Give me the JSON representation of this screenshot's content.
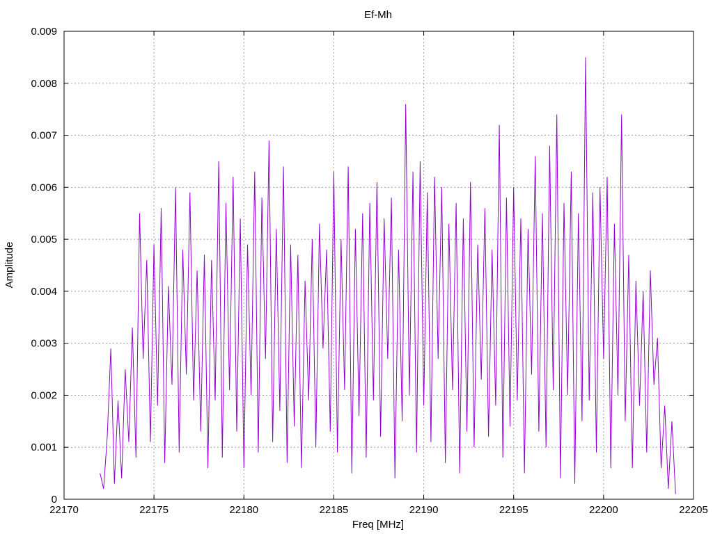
{
  "chart_data": {
    "type": "line",
    "title": "Ef-Mh",
    "xlabel": "Freq [MHz]",
    "ylabel": "Amplitude",
    "xlim": [
      22170,
      22205
    ],
    "ylim": [
      0,
      0.009
    ],
    "x_ticks": [
      22170,
      22175,
      22180,
      22185,
      22190,
      22195,
      22200,
      22205
    ],
    "x_tick_labels": [
      "22170",
      "22175",
      "22180",
      "22185",
      "22190",
      "22195",
      "22200",
      "22205"
    ],
    "y_ticks": [
      0,
      0.001,
      0.002,
      0.003,
      0.004,
      0.005,
      0.006,
      0.007,
      0.008,
      0.009
    ],
    "y_tick_labels": [
      "0",
      "0.001",
      "0.002",
      "0.003",
      "0.004",
      "0.005",
      "0.006",
      "0.007",
      "0.008",
      "0.009"
    ],
    "grid": true,
    "legend": "none",
    "series": [
      {
        "color": "#9400d3",
        "x": [
          22172.0,
          22172.2,
          22172.4,
          22172.6,
          22172.8,
          22173.0,
          22173.2,
          22173.4,
          22173.6,
          22173.8,
          22174.0,
          22174.2,
          22174.4,
          22174.6,
          22174.8,
          22175.0,
          22175.2,
          22175.4,
          22175.6,
          22175.8,
          22176.0,
          22176.2,
          22176.4,
          22176.6,
          22176.8,
          22177.0,
          22177.2,
          22177.4,
          22177.6,
          22177.8,
          22178.0,
          22178.2,
          22178.4,
          22178.6,
          22178.8,
          22179.0,
          22179.2,
          22179.4,
          22179.6,
          22179.8,
          22180.0,
          22180.2,
          22180.4,
          22180.6,
          22180.8,
          22181.0,
          22181.2,
          22181.4,
          22181.6,
          22181.8,
          22182.0,
          22182.2,
          22182.4,
          22182.6,
          22182.8,
          22183.0,
          22183.2,
          22183.4,
          22183.6,
          22183.8,
          22184.0,
          22184.2,
          22184.4,
          22184.6,
          22184.8,
          22185.0,
          22185.2,
          22185.4,
          22185.6,
          22185.8,
          22186.0,
          22186.2,
          22186.4,
          22186.6,
          22186.8,
          22187.0,
          22187.2,
          22187.4,
          22187.6,
          22187.8,
          22188.0,
          22188.2,
          22188.4,
          22188.6,
          22188.8,
          22189.0,
          22189.2,
          22189.4,
          22189.6,
          22189.8,
          22190.0,
          22190.2,
          22190.4,
          22190.6,
          22190.8,
          22191.0,
          22191.2,
          22191.4,
          22191.6,
          22191.8,
          22192.0,
          22192.2,
          22192.4,
          22192.6,
          22192.8,
          22193.0,
          22193.2,
          22193.4,
          22193.6,
          22193.8,
          22194.0,
          22194.2,
          22194.4,
          22194.6,
          22194.8,
          22195.0,
          22195.2,
          22195.4,
          22195.6,
          22195.8,
          22196.0,
          22196.2,
          22196.4,
          22196.6,
          22196.8,
          22197.0,
          22197.2,
          22197.4,
          22197.6,
          22197.8,
          22198.0,
          22198.2,
          22198.4,
          22198.6,
          22198.8,
          22199.0,
          22199.2,
          22199.4,
          22199.6,
          22199.8,
          22200.0,
          22200.2,
          22200.4,
          22200.6,
          22200.8,
          22201.0,
          22201.2,
          22201.4,
          22201.6,
          22201.8,
          22202.0,
          22202.2,
          22202.4,
          22202.6,
          22202.8,
          22203.0,
          22203.2,
          22203.4,
          22203.6,
          22203.8,
          22204.0
        ],
        "y": [
          0.0005,
          0.0002,
          0.0012,
          0.0029,
          0.0003,
          0.0019,
          0.0004,
          0.0025,
          0.0011,
          0.0033,
          0.0008,
          0.0055,
          0.0027,
          0.0046,
          0.0011,
          0.0049,
          0.0018,
          0.0056,
          0.0007,
          0.0041,
          0.0022,
          0.006,
          0.0009,
          0.0048,
          0.0024,
          0.0059,
          0.0019,
          0.0044,
          0.0013,
          0.0047,
          0.0006,
          0.0046,
          0.0019,
          0.0065,
          0.0008,
          0.0057,
          0.0021,
          0.0062,
          0.0013,
          0.0054,
          0.0006,
          0.0049,
          0.002,
          0.0063,
          0.0009,
          0.0058,
          0.0027,
          0.0069,
          0.0011,
          0.0052,
          0.0017,
          0.0064,
          0.0007,
          0.0049,
          0.0014,
          0.0047,
          0.0006,
          0.0042,
          0.0019,
          0.005,
          0.001,
          0.0053,
          0.0029,
          0.0048,
          0.0013,
          0.0063,
          0.0009,
          0.005,
          0.0021,
          0.0064,
          0.0005,
          0.0052,
          0.0016,
          0.0055,
          0.0008,
          0.0057,
          0.0019,
          0.0061,
          0.0012,
          0.0054,
          0.0027,
          0.0058,
          0.0004,
          0.0048,
          0.0015,
          0.0076,
          0.002,
          0.0063,
          0.0009,
          0.0065,
          0.0018,
          0.0059,
          0.0011,
          0.0062,
          0.0027,
          0.006,
          0.0007,
          0.0053,
          0.0021,
          0.0057,
          0.0005,
          0.0054,
          0.0013,
          0.0061,
          0.001,
          0.0049,
          0.0023,
          0.0056,
          0.0012,
          0.0048,
          0.0018,
          0.0072,
          0.0008,
          0.0058,
          0.0014,
          0.006,
          0.0019,
          0.0054,
          0.0005,
          0.0052,
          0.0024,
          0.0066,
          0.0013,
          0.0055,
          0.001,
          0.0068,
          0.0021,
          0.0074,
          0.0004,
          0.0057,
          0.002,
          0.0063,
          0.0003,
          0.0055,
          0.0015,
          0.0085,
          0.0019,
          0.0059,
          0.0009,
          0.006,
          0.0027,
          0.0062,
          0.0006,
          0.0053,
          0.002,
          0.0074,
          0.0015,
          0.0047,
          0.0006,
          0.0042,
          0.0018,
          0.004,
          0.0009,
          0.0044,
          0.0022,
          0.0031,
          0.0006,
          0.0018,
          0.0002,
          0.0015,
          0.0001
        ]
      }
    ]
  }
}
